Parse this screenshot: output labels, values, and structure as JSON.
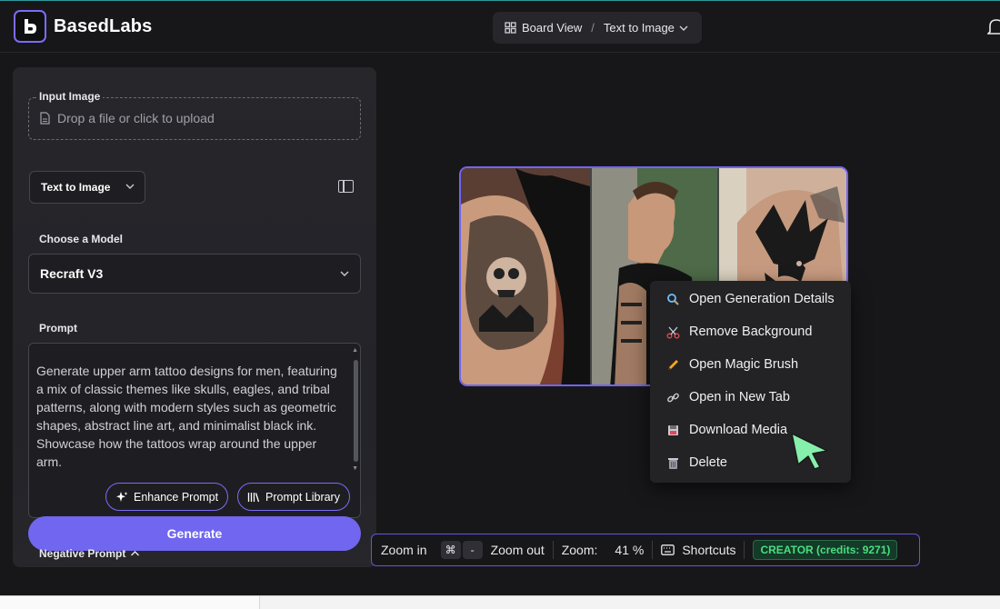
{
  "app": {
    "name": "BasedLabs"
  },
  "header": {
    "breadcrumb_board": "Board View",
    "breadcrumb_separator": "/",
    "breadcrumb_current": "Text to Image"
  },
  "panel": {
    "input_image_label": "Input Image",
    "drop_placeholder": "Drop a file or click to upload",
    "mode_value": "Text to Image",
    "model_label": "Choose a Model",
    "model_value": "Recraft V3",
    "prompt_label": "Prompt",
    "prompt_text": "Generate upper arm tattoo designs for men, featuring a mix of classic themes like skulls, eagles, and tribal patterns, along with modern styles such as geometric shapes, abstract line art, and minimalist black ink. Showcase how the tattoos wrap around the upper arm.",
    "enhance_prompt_label": "Enhance Prompt",
    "prompt_library_label": "Prompt Library",
    "generate_label": "Generate",
    "negative_prompt_label": "Negative Prompt"
  },
  "context_menu": {
    "items": [
      {
        "label": "Open Generation Details",
        "icon": "magnifier-icon"
      },
      {
        "label": "Remove Background",
        "icon": "scissors-icon"
      },
      {
        "label": "Open Magic Brush",
        "icon": "pencil-icon"
      },
      {
        "label": "Open in New Tab",
        "icon": "link-icon"
      },
      {
        "label": "Download Media",
        "icon": "floppy-disk-icon"
      },
      {
        "label": "Delete",
        "icon": "trash-icon"
      }
    ]
  },
  "toolbar": {
    "zoom_in_label": "Zoom in",
    "cmd_key": "⌘",
    "minus_key": "-",
    "zoom_out_label": "Zoom out",
    "zoom_label": "Zoom:",
    "zoom_value": "41 %",
    "shortcuts_label": "Shortcuts",
    "credits_badge": "CREATOR (credits: 9271)"
  },
  "colors": {
    "accent": "#7066f0",
    "panel_bg": "#26262b",
    "credits_green": "#4ade80",
    "cursor_green": "#86efac"
  }
}
